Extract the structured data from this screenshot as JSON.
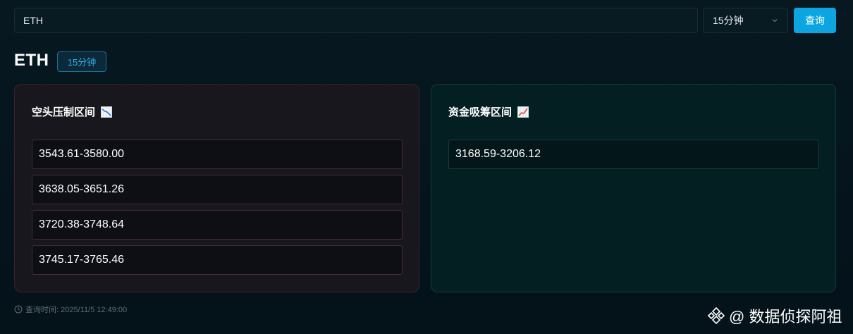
{
  "search": {
    "value": "ETH"
  },
  "interval_select": {
    "selected": "15分钟"
  },
  "query_button": {
    "label": "查询"
  },
  "header": {
    "symbol": "ETH",
    "interval_badge": "15分钟"
  },
  "bear_panel": {
    "title": "空头压制区间",
    "icon": "chart-decreasing-icon",
    "ranges": [
      "3543.61-3580.00",
      "3638.05-3651.26",
      "3720.38-3748.64",
      "3745.17-3765.46"
    ]
  },
  "bull_panel": {
    "title": "资金吸筹区间",
    "icon": "chart-increasing-icon",
    "ranges": [
      "3168.59-3206.12"
    ]
  },
  "footer": {
    "query_time": "查询时间: 2025/11/5 12:49:00"
  },
  "watermark": {
    "text": "@ 数据侦探阿祖"
  },
  "colors": {
    "accent": "#0aa6e3",
    "bear_border": "#4a2a30",
    "bull_bg": "#041f22",
    "background": "#06141b"
  }
}
